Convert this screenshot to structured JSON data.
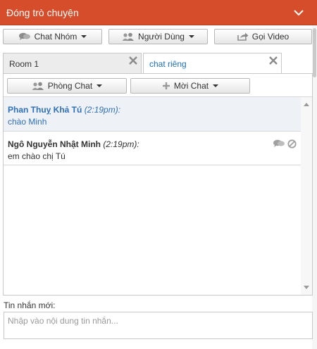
{
  "header": {
    "title": "Đóng trò chuyện",
    "chevron_icon": "chevron-down-icon"
  },
  "toolbar": {
    "group_chat": {
      "label": "Chat Nhóm",
      "icon": "chat-bubbles-icon"
    },
    "users": {
      "label": "Người Dùng",
      "icon": "users-icon"
    },
    "video": {
      "label": "Gọi Video",
      "icon": "share-arrow-icon"
    }
  },
  "tabs": [
    {
      "label": "Room 1",
      "active": false
    },
    {
      "label": "chat riêng",
      "active": true
    }
  ],
  "subbar": {
    "rooms": {
      "label": "Phòng Chat",
      "icon": "users-icon"
    },
    "invite": {
      "label": "Mời Chat",
      "icon": "plus-icon"
    }
  },
  "messages": [
    {
      "name": "Phan Thuỵ Khả Tú",
      "time": "(2:19pm)",
      "sep": ":",
      "text": "chào Minh"
    },
    {
      "name": "Ngô Nguyễn Nhật Minh",
      "time": "(2:19pm)",
      "sep": ":",
      "text": "em chào chị Tú"
    }
  ],
  "compose": {
    "label": "Tin nhắn mới:",
    "placeholder": "Nhập vào nội dung tin nhắn..."
  },
  "colors": {
    "header_bg": "#d54d2a",
    "link_blue": "#2f6fb7"
  }
}
